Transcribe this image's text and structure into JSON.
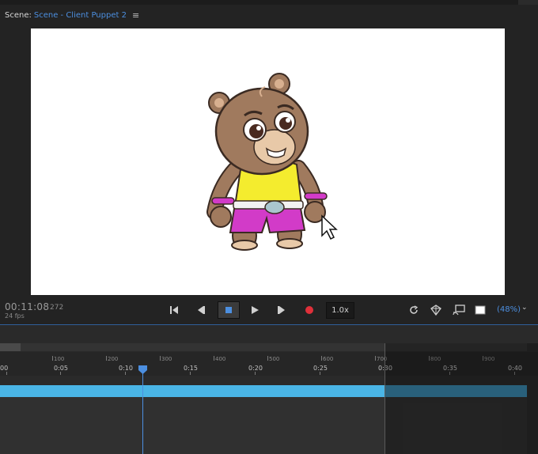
{
  "panel": {
    "scene_label": "Scene:",
    "scene_name": "Scene - Client Puppet 2",
    "menu_icon": "hamburger-menu-icon"
  },
  "transport": {
    "current_time": "00:11:08",
    "current_frame": "272",
    "fps": "24 fps",
    "speed": "1.0x",
    "zoom": "(48%)",
    "buttons": [
      "go-to-start-icon",
      "step-back-icon",
      "stop-icon",
      "play-icon",
      "step-forward-icon",
      "record-icon"
    ],
    "right_tools": [
      "loop-icon",
      "3d-view-icon",
      "stream-icon",
      "background-color-swatch"
    ]
  },
  "timeline": {
    "frame_numbers": [
      "100",
      "200",
      "300",
      "400",
      "500",
      "600",
      "700",
      "800",
      "900"
    ],
    "time_labels": [
      "00",
      "0:05",
      "0:10",
      "0:15",
      "0:20",
      "0:25",
      "0:30",
      "0:35",
      "0:40"
    ],
    "playhead_frame": 272
  },
  "colors": {
    "accent_blue": "#4c8fe0",
    "track_blue": "#4ab5e6",
    "record_red": "#e0303a",
    "panel_bg": "#232323"
  }
}
